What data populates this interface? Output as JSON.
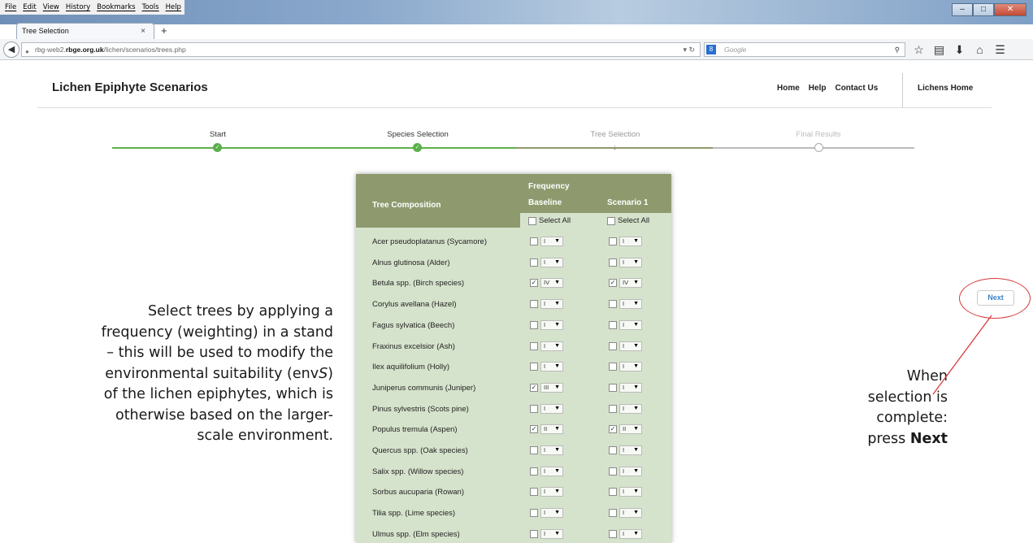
{
  "browser": {
    "menu": [
      "File",
      "Edit",
      "View",
      "History",
      "Bookmarks",
      "Tools",
      "Help"
    ],
    "tab_title": "Tree Selection",
    "tab_close": "×",
    "new_tab": "+",
    "url_prefix": "rbg-web2.",
    "url_host": "rbge.org.uk",
    "url_path": "/lichen/scenarios/trees.php",
    "search_placeholder": "Google",
    "search_engine": "8",
    "toolbar_icons": [
      "star-icon",
      "bookmarks-list-icon",
      "download-icon",
      "home-icon",
      "menu-icon"
    ]
  },
  "site": {
    "title": "Lichen Epiphyte Scenarios",
    "nav": [
      "Home",
      "Help",
      "Contact Us"
    ],
    "lichens_home": "Lichens Home"
  },
  "progress": {
    "steps": [
      {
        "label": "Start",
        "state": "done"
      },
      {
        "label": "Species Selection",
        "state": "done"
      },
      {
        "label": "Tree Selection",
        "state": "current"
      },
      {
        "label": "Final Results",
        "state": "todo"
      }
    ]
  },
  "table": {
    "title": "Tree Composition",
    "frequency": "Frequency",
    "baseline": "Baseline",
    "scenario": "Scenario 1",
    "select_all": "Select All",
    "rows": [
      {
        "name": "Acer pseudoplatanus (Sycamore)",
        "base_checked": false,
        "base_val": "I",
        "scen_checked": false,
        "scen_val": "I"
      },
      {
        "name": "Alnus glutinosa (Alder)",
        "base_checked": false,
        "base_val": "I",
        "scen_checked": false,
        "scen_val": "I"
      },
      {
        "name": "Betula spp. (Birch species)",
        "base_checked": true,
        "base_val": "IV",
        "scen_checked": true,
        "scen_val": "IV"
      },
      {
        "name": "Corylus avellana (Hazel)",
        "base_checked": false,
        "base_val": "I",
        "scen_checked": false,
        "scen_val": "I"
      },
      {
        "name": "Fagus sylvatica (Beech)",
        "base_checked": false,
        "base_val": "I",
        "scen_checked": false,
        "scen_val": "I"
      },
      {
        "name": "Fraxinus excelsior (Ash)",
        "base_checked": false,
        "base_val": "I",
        "scen_checked": false,
        "scen_val": "I"
      },
      {
        "name": "Ilex aquilifolium (Holly)",
        "base_checked": false,
        "base_val": "I",
        "scen_checked": false,
        "scen_val": "I"
      },
      {
        "name": "Juniperus communis (Juniper)",
        "base_checked": true,
        "base_val": "III",
        "scen_checked": false,
        "scen_val": "I"
      },
      {
        "name": "Pinus sylvestris (Scots pine)",
        "base_checked": false,
        "base_val": "I",
        "scen_checked": false,
        "scen_val": "I"
      },
      {
        "name": "Populus tremula (Aspen)",
        "base_checked": true,
        "base_val": "II",
        "scen_checked": true,
        "scen_val": "II"
      },
      {
        "name": "Quercus spp. (Oak species)",
        "base_checked": false,
        "base_val": "I",
        "scen_checked": false,
        "scen_val": "I"
      },
      {
        "name": "Salix spp. (Willow species)",
        "base_checked": false,
        "base_val": "I",
        "scen_checked": false,
        "scen_val": "I"
      },
      {
        "name": "Sorbus aucuparia (Rowan)",
        "base_checked": false,
        "base_val": "I",
        "scen_checked": false,
        "scen_val": "I"
      },
      {
        "name": "Tilia spp. (Lime species)",
        "base_checked": false,
        "base_val": "I",
        "scen_checked": false,
        "scen_val": "I"
      },
      {
        "name": "Ulmus spp. (Elm species)",
        "base_checked": false,
        "base_val": "I",
        "scen_checked": false,
        "scen_val": "I"
      }
    ]
  },
  "instructions": {
    "line1": "Select trees by applying a",
    "line2": "frequency (weighting) in a stand",
    "line3": "– this will be used to modify the",
    "line4_pre": "environmental suitability (env",
    "line4_italic": "S",
    "line4_post": ")",
    "line5": "of the lichen epiphytes, which is",
    "line6": "otherwise based on the larger-",
    "line7": "scale environment."
  },
  "annotation": {
    "line1": "When",
    "line2": "selection is",
    "line3": "complete:",
    "line4_pre": "press ",
    "line4_bold": "Next",
    "highlight_color": "#d83a3a"
  },
  "next_button": "Next",
  "colors": {
    "progress_done": "#5ab04a",
    "progress_current": "#8e9a6e",
    "table_header": "#8e9a6e",
    "table_body": "#d6e3cc",
    "next_text": "#3b82c4"
  }
}
